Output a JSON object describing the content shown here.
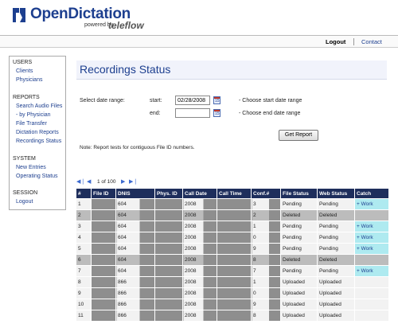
{
  "header": {
    "logo_text": "OpenDictation",
    "powered_by": "powered by",
    "logo_brand": "teleflow",
    "logo_mark_icon": "od-logo-mark-icon",
    "brand_color": "#1d3f8f"
  },
  "topnav": {
    "logout": "Logout",
    "separator": "|",
    "contact": "Contact"
  },
  "sidebar": {
    "users_heading": "USERS",
    "clients": "Clients",
    "physicians": "Physicians",
    "reports_heading": "REPORTS",
    "search_audio_files": "Search Audio Files",
    "by_physician": " - by Physician",
    "file_transfer": "File Transfer",
    "dictation_reports": "Dictation Reports",
    "recordings_status": "Recordings Status",
    "system_heading": "SYSTEM",
    "new_entries": "New Entries",
    "operating_status": "Operating Status",
    "session_heading": "SESSION",
    "logout": "Logout"
  },
  "main": {
    "title": "Recordings Status",
    "date_range_label": "Select date range:",
    "start_label": "start:",
    "start_value": "02/28/2008",
    "start_hint": "- Choose start date range",
    "end_label": "end:",
    "end_value": "",
    "end_hint": "- Choose end date range",
    "get_report": "Get Report",
    "note": "Note: Report tests for contiguous File ID numbers."
  },
  "pager": {
    "first_icon": "first-page-icon",
    "prev_icon": "prev-page-icon",
    "next_icon": "next-page-icon",
    "last_icon": "last-page-icon",
    "info": "1 of 100"
  },
  "table": {
    "columns": [
      "#",
      "File ID",
      "DNIS",
      "Phys. ID",
      "Call Date",
      "Call Time",
      "Conf.#",
      "File Status",
      "Web Status",
      "Catch"
    ],
    "rows": [
      {
        "n": "1",
        "file_id": "",
        "dnis": "604",
        "phys_id": "2",
        "call_date": "2008",
        "call_time": "",
        "conf": "3",
        "file_status": "Pending",
        "web_status": "Pending",
        "catch": "+ Work",
        "deleted": false
      },
      {
        "n": "2",
        "file_id": "",
        "dnis": "604",
        "phys_id": "2",
        "call_date": "2008",
        "call_time": "",
        "conf": "2",
        "file_status": "Deleted",
        "web_status": "Deleted",
        "catch": "",
        "deleted": true
      },
      {
        "n": "3",
        "file_id": "",
        "dnis": "604",
        "phys_id": "2",
        "call_date": "2008",
        "call_time": "",
        "conf": "1",
        "file_status": "Pending",
        "web_status": "Pending",
        "catch": "+ Work",
        "deleted": false
      },
      {
        "n": "4",
        "file_id": "",
        "dnis": "604",
        "phys_id": "2",
        "call_date": "2008",
        "call_time": "",
        "conf": "0",
        "file_status": "Pending",
        "web_status": "Pending",
        "catch": "+ Work",
        "deleted": false
      },
      {
        "n": "5",
        "file_id": "",
        "dnis": "604",
        "phys_id": "2",
        "call_date": "2008",
        "call_time": "",
        "conf": "9",
        "file_status": "Pending",
        "web_status": "Pending",
        "catch": "+ Work",
        "deleted": false
      },
      {
        "n": "6",
        "file_id": "",
        "dnis": "604",
        "phys_id": "2",
        "call_date": "2008",
        "call_time": "",
        "conf": "8",
        "file_status": "Deleted",
        "web_status": "Deleted",
        "catch": "",
        "deleted": true
      },
      {
        "n": "7",
        "file_id": "",
        "dnis": "604",
        "phys_id": "2",
        "call_date": "2008",
        "call_time": "",
        "conf": "7",
        "file_status": "Pending",
        "web_status": "Pending",
        "catch": "+ Work",
        "deleted": false
      },
      {
        "n": "8",
        "file_id": "",
        "dnis": "866",
        "phys_id": "1",
        "call_date": "2008",
        "call_time": "",
        "conf": "1",
        "file_status": "Uploaded",
        "web_status": "Uploaded",
        "catch": "",
        "deleted": false
      },
      {
        "n": "9",
        "file_id": "",
        "dnis": "866",
        "phys_id": "3",
        "call_date": "2008",
        "call_time": "",
        "conf": "0",
        "file_status": "Uploaded",
        "web_status": "Uploaded",
        "catch": "",
        "deleted": false
      },
      {
        "n": "10",
        "file_id": "",
        "dnis": "866",
        "phys_id": "2",
        "call_date": "2008",
        "call_time": "",
        "conf": "9",
        "file_status": "Uploaded",
        "web_status": "Uploaded",
        "catch": "",
        "deleted": false
      },
      {
        "n": "11",
        "file_id": "",
        "dnis": "866",
        "phys_id": "0",
        "call_date": "2008",
        "call_time": "",
        "conf": "8",
        "file_status": "Uploaded",
        "web_status": "Uploaded",
        "catch": "",
        "deleted": false
      }
    ]
  },
  "colors": {
    "table_header": "#1e2e5c",
    "row_normal": "#f2f2f2",
    "row_deleted": "#bcbcbc",
    "redaction": "#8e8e8e",
    "catch_work": "#aeeaf0",
    "link": "#1d3f8f"
  }
}
